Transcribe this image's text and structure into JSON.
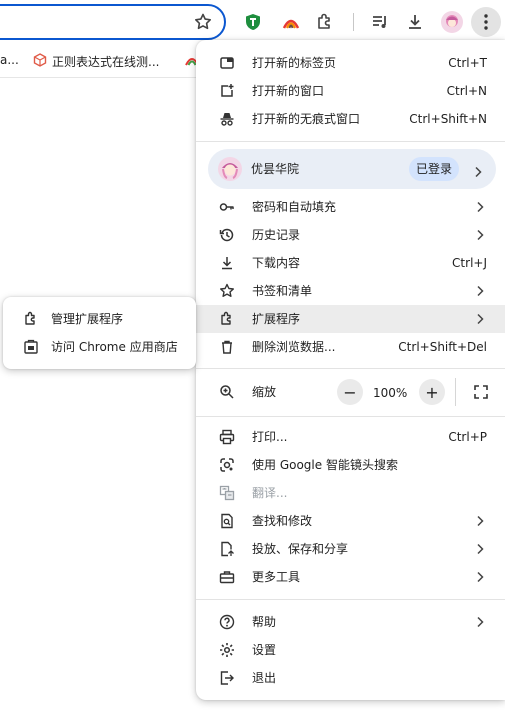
{
  "bookmarks": {
    "items": [
      {
        "label": "a..."
      },
      {
        "label": "正则表达式在线测..."
      }
    ]
  },
  "menu": {
    "new_tab": {
      "label": "打开新的标签页",
      "shortcut": "Ctrl+T"
    },
    "new_window": {
      "label": "打开新的窗口",
      "shortcut": "Ctrl+N"
    },
    "incognito": {
      "label": "打开新的无痕式窗口",
      "shortcut": "Ctrl+Shift+N"
    },
    "profile": {
      "name": "优昙华院",
      "status": "已登录"
    },
    "passwords": {
      "label": "密码和自动填充"
    },
    "history": {
      "label": "历史记录"
    },
    "downloads": {
      "label": "下载内容",
      "shortcut": "Ctrl+J"
    },
    "bookmarks": {
      "label": "书签和清单"
    },
    "extensions": {
      "label": "扩展程序"
    },
    "clear_data": {
      "label": "删除浏览数据...",
      "shortcut": "Ctrl+Shift+Del"
    },
    "zoom": {
      "label": "缩放",
      "minus": "−",
      "value": "100%",
      "plus": "+"
    },
    "print": {
      "label": "打印...",
      "shortcut": "Ctrl+P"
    },
    "lens": {
      "label": "使用 Google 智能镜头搜索"
    },
    "translate": {
      "label": "翻译..."
    },
    "find_edit": {
      "label": "查找和修改"
    },
    "cast_save_share": {
      "label": "投放、保存和分享"
    },
    "more_tools": {
      "label": "更多工具"
    },
    "help": {
      "label": "帮助"
    },
    "settings": {
      "label": "设置"
    },
    "exit": {
      "label": "退出"
    }
  },
  "submenu": {
    "manage_extensions": {
      "label": "管理扩展程序"
    },
    "web_store": {
      "label": "访问 Chrome 应用商店"
    }
  },
  "colors": {
    "accent": "#0b57d0",
    "profile_bg": "#e9eef6",
    "signed_in_pill": "#d3e3fd",
    "hover_bg": "#ececec",
    "extension_green": "#1e8e3e"
  },
  "icons": {
    "toolbar": [
      "bookmark-star-icon",
      "green-shield-extension-icon",
      "rainbow-extension-icon",
      "puzzle-extensions-icon",
      "media-queue-icon",
      "download-icon",
      "profile-avatar-icon",
      "kebab-menu-icon"
    ]
  }
}
